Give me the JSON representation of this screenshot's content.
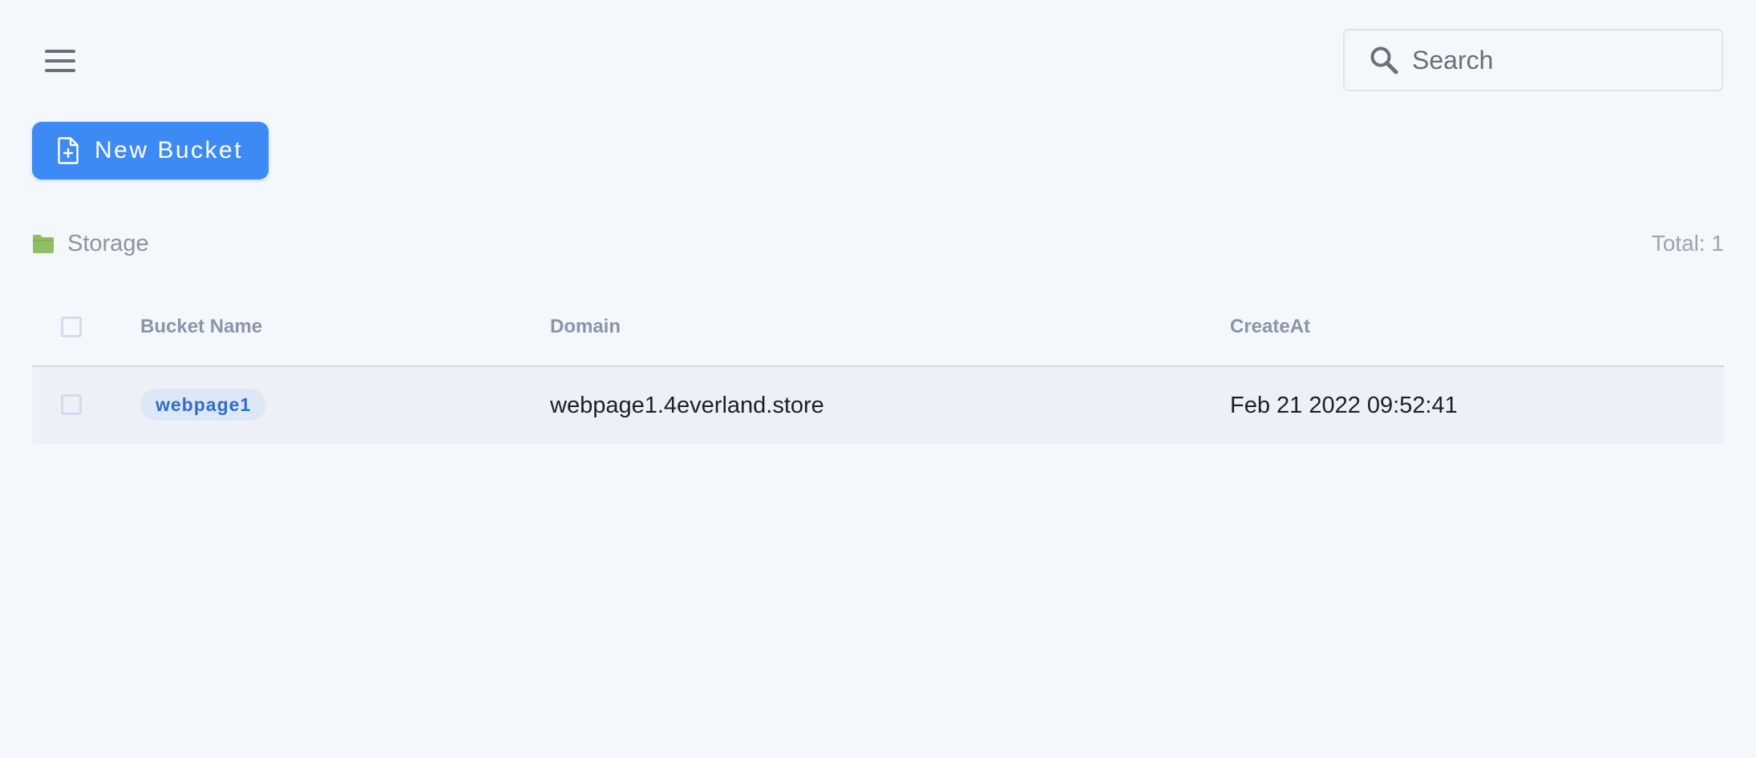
{
  "header": {
    "menu_icon": "hamburger-menu-icon",
    "search": {
      "placeholder": "Search",
      "value": "",
      "icon": "search-icon"
    }
  },
  "toolbar": {
    "new_bucket_label": "New Bucket",
    "new_bucket_icon": "file-plus-icon",
    "accent_color": "#3e8af4"
  },
  "breadcrumb": {
    "icon": "folder-icon",
    "icon_color": "#8ebf63",
    "label": "Storage"
  },
  "summary": {
    "total_label": "Total: 1"
  },
  "table": {
    "columns": [
      "Bucket Name",
      "Domain",
      "CreateAt"
    ],
    "rows": [
      {
        "bucket_name": "webpage1",
        "domain": "webpage1.4everland.store",
        "created_at": "Feb 21 2022 09:52:41"
      }
    ]
  }
}
